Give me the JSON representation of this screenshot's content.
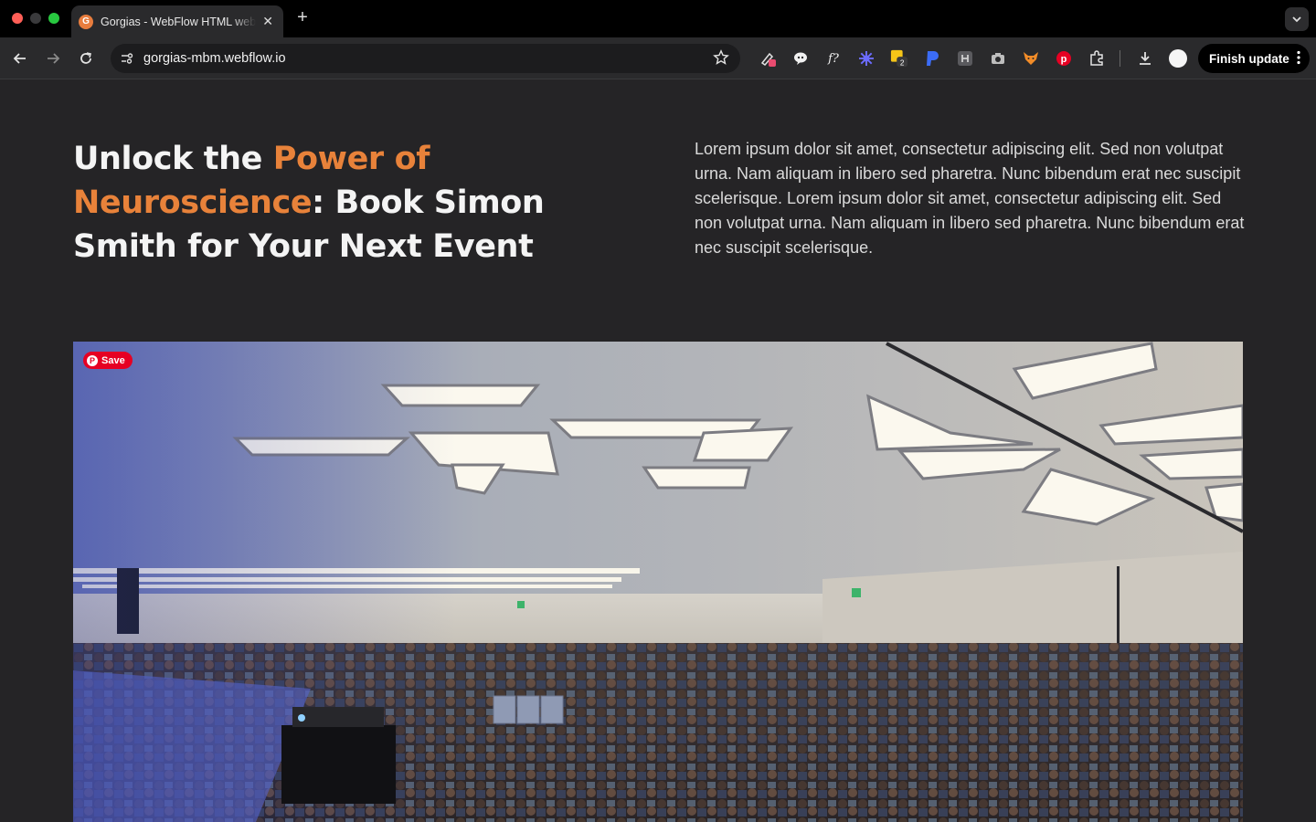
{
  "browser": {
    "tab": {
      "favicon_letter": "G",
      "title": "Gorgias - WebFlow HTML website"
    },
    "address": {
      "url": "gorgias-mbm.webflow.io"
    },
    "finish_update_label": "Finish update",
    "extension_badge_count": "2"
  },
  "hero": {
    "title_part1": "Unlock the ",
    "title_accent": "Power of Neuroscience",
    "title_part2": ": Book Simon Smith for Your Next Event",
    "body": "Lorem ipsum dolor sit amet, consectetur adipiscing elit. Sed non volutpat urna. Nam aliquam in libero sed pharetra. Nunc bibendum erat nec suscipit scelerisque. Lorem ipsum dolor sit amet, consectetur adipiscing elit. Sed non volutpat urna. Nam aliquam in libero sed pharetra. Nunc bibendum erat nec suscipit scelerisque."
  },
  "image": {
    "save_label": "Save"
  },
  "colors": {
    "accent": "#e8823a",
    "page_bg": "#252426",
    "pinterest": "#e60023"
  }
}
